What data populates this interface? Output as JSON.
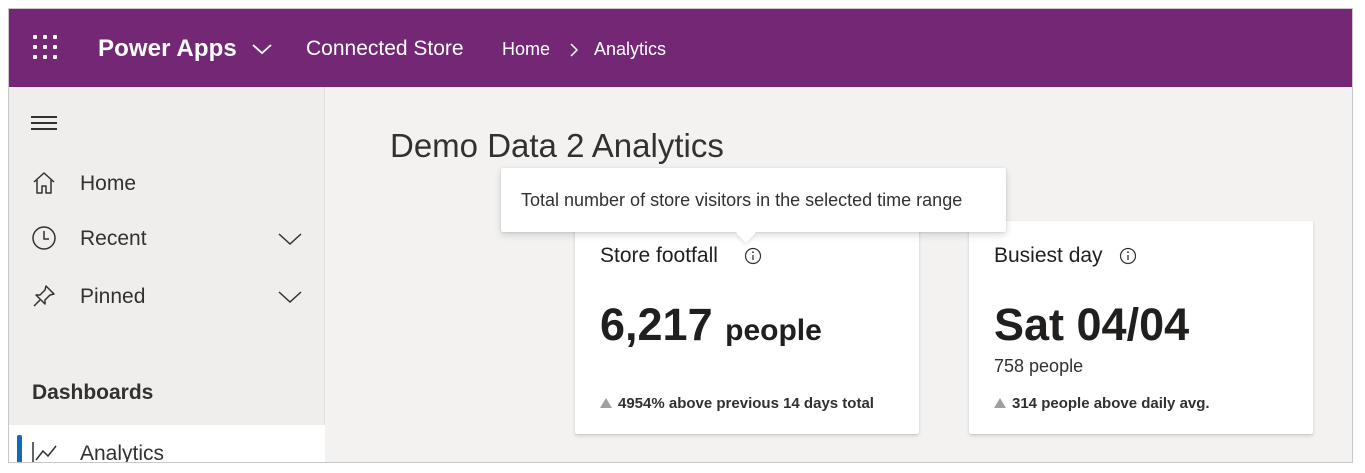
{
  "header": {
    "app_name": "Power Apps",
    "store_name": "Connected Store",
    "breadcrumb": {
      "home": "Home",
      "current": "Analytics"
    },
    "background_color": "#742774"
  },
  "sidebar": {
    "items": [
      {
        "label": "Home",
        "icon": "home-icon",
        "expandable": false
      },
      {
        "label": "Recent",
        "icon": "clock-icon",
        "expandable": true
      },
      {
        "label": "Pinned",
        "icon": "pin-icon",
        "expandable": true
      }
    ],
    "section_label": "Dashboards",
    "active_item": {
      "label": "Analytics",
      "icon": "trend-icon"
    },
    "accent_color": "#0f6cbd"
  },
  "main": {
    "title": "Demo Data 2 Analytics",
    "tooltip": "Total number of store visitors in the selected time range",
    "cards": [
      {
        "title": "Store footfall",
        "value": "6,217",
        "unit": "people",
        "footnote": "4954% above previous 14 days total"
      },
      {
        "title": "Busiest day",
        "value": "Sat 04/04",
        "sub": "758 people",
        "footnote": "314 people above daily avg."
      }
    ]
  }
}
